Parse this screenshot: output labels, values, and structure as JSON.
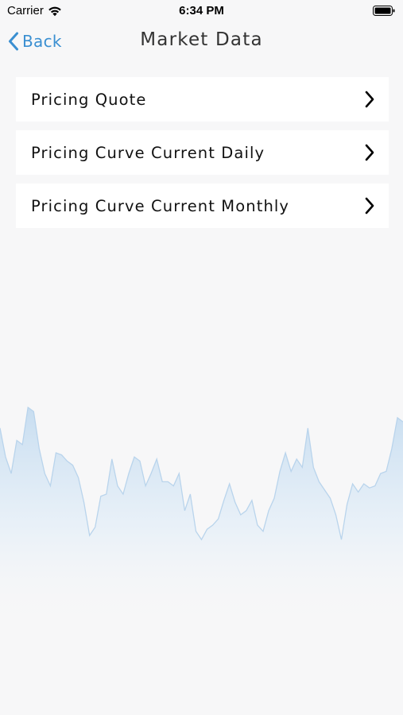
{
  "status_bar": {
    "carrier": "Carrier",
    "time": "6:34 PM",
    "wifi_icon": "wifi-icon",
    "battery_icon": "battery-icon"
  },
  "nav": {
    "back_label": "Back",
    "title": "Market Data",
    "accent_color": "#3a8fd1"
  },
  "menu": {
    "items": [
      {
        "label": "Pricing Quote",
        "icon": "chevron-right-icon"
      },
      {
        "label": "Pricing Curve Current Daily",
        "icon": "chevron-right-icon"
      },
      {
        "label": "Pricing Curve Current Monthly",
        "icon": "chevron-right-icon"
      }
    ]
  },
  "background_chart": {
    "color": "#b9d4ec",
    "values": [
      62,
      48,
      40,
      56,
      54,
      72,
      70,
      52,
      40,
      34,
      50,
      49,
      46,
      44,
      38,
      26,
      10,
      14,
      29,
      30,
      47,
      34,
      30,
      40,
      48,
      46,
      34,
      40,
      47,
      36,
      36,
      34,
      40,
      22,
      30,
      12,
      8,
      13,
      15,
      18,
      27,
      35,
      26,
      20,
      22,
      27,
      15,
      12,
      22,
      28,
      41,
      50,
      41,
      47,
      43,
      62,
      43,
      36,
      32,
      28,
      20,
      8,
      25,
      35,
      31,
      35,
      33,
      34,
      40,
      41,
      52,
      67,
      65
    ]
  }
}
